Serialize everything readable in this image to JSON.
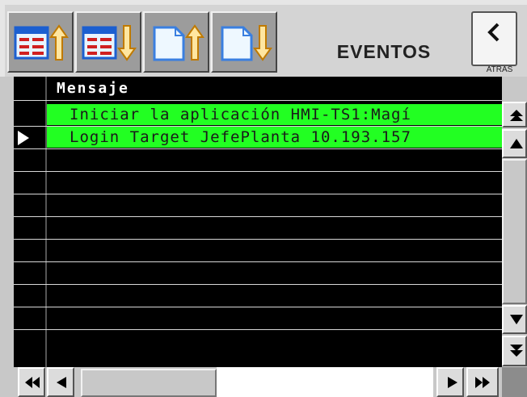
{
  "title": "EVENTOS",
  "back": {
    "label": "ATRAS"
  },
  "toolbar": {
    "buttons": [
      {
        "icon": "sort-list-up-icon"
      },
      {
        "icon": "sort-list-down-icon"
      },
      {
        "icon": "page-up-icon"
      },
      {
        "icon": "page-down-icon"
      }
    ]
  },
  "table": {
    "column_header": "Mensaje",
    "rows": [
      "Iniciar la aplicación HMI-TS1:Magí",
      "Login Target JefePlanta 10.193.157"
    ],
    "selected_row": 1,
    "highlight_color": "#22ff22"
  }
}
